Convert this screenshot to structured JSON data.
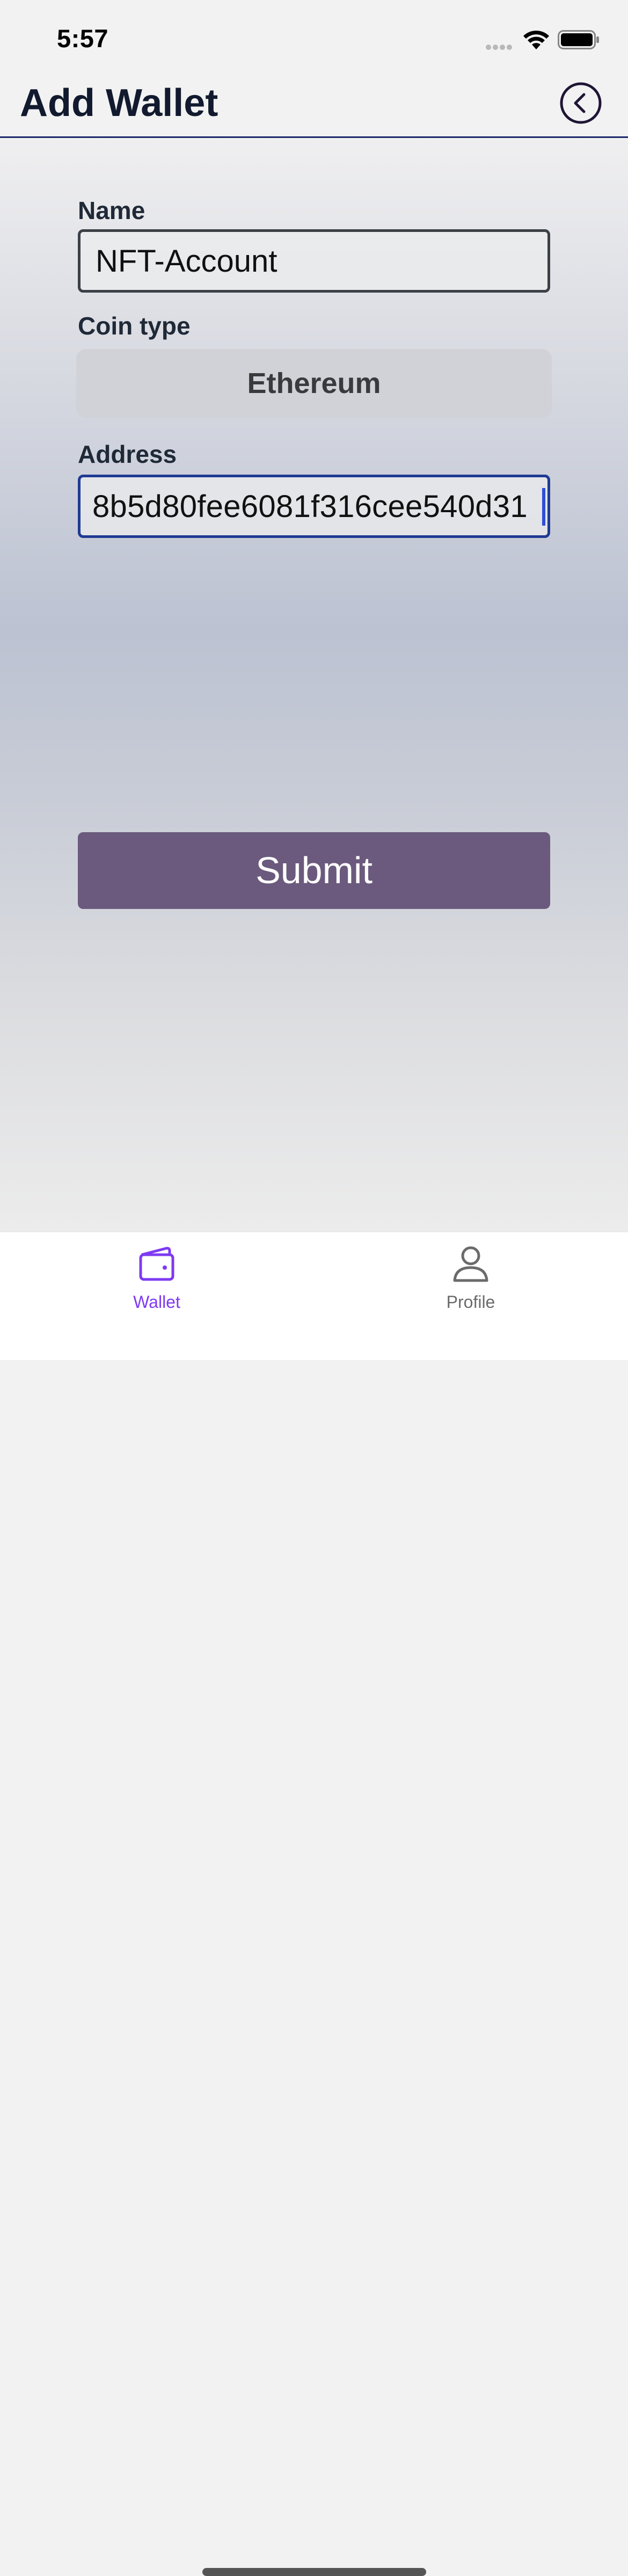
{
  "status_bar": {
    "time": "5:57"
  },
  "header": {
    "title": "Add Wallet",
    "back_icon": "chevron-left-circle-icon"
  },
  "form": {
    "name_label": "Name",
    "name_value": "NFT-Account",
    "coin_label": "Coin type",
    "coin_value": "Ethereum",
    "address_label": "Address",
    "address_value": "8b5d80fee6081f316cee540d31"
  },
  "submit": {
    "label": "Submit"
  },
  "tabs": [
    {
      "label": "Wallet",
      "icon": "wallet-icon",
      "active": true
    },
    {
      "label": "Profile",
      "icon": "person-icon",
      "active": false
    }
  ],
  "colors": {
    "accent": "#7e3af2",
    "submit_bg": "#6b5a7d",
    "header_rule": "#1b2a6b",
    "focus_border": "#1f3a93"
  }
}
